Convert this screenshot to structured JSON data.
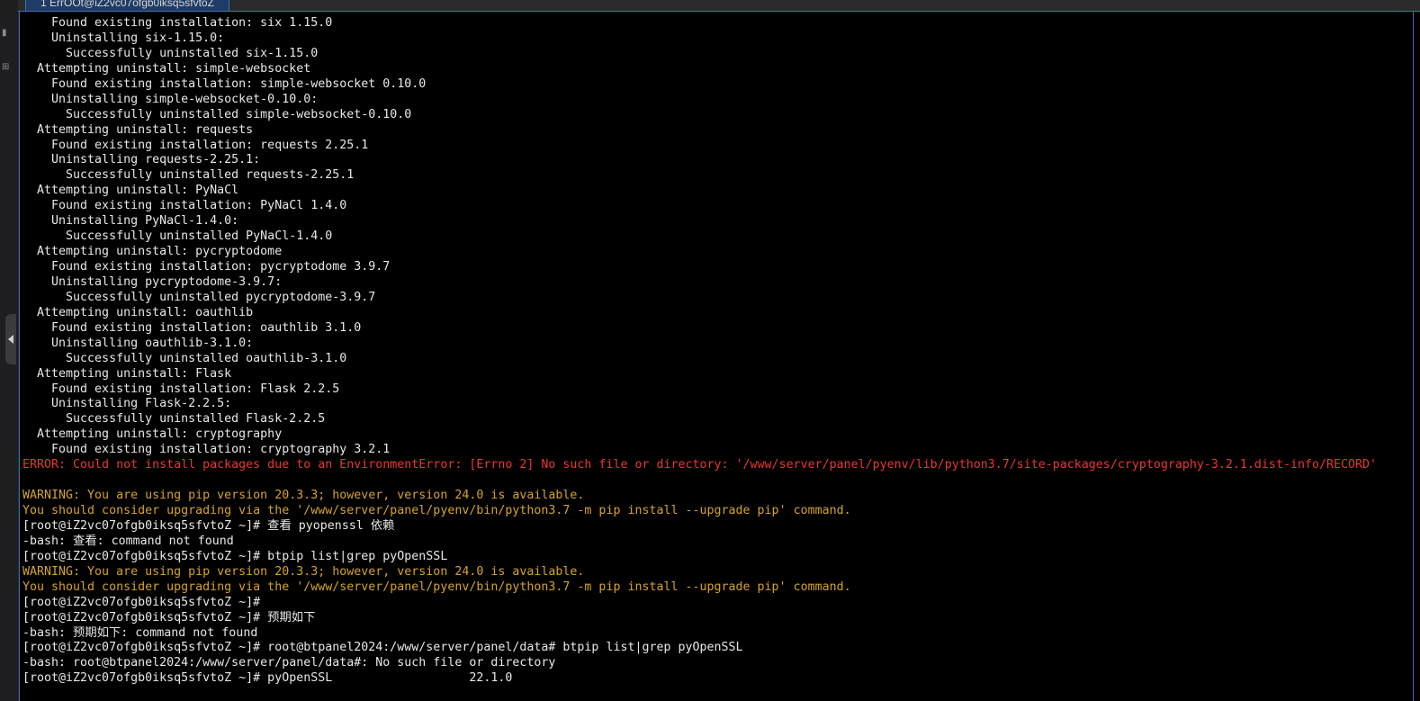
{
  "tab": {
    "title": "1 ErrOOt@iZ2vc07ofgb0iksq5sfvtoZ"
  },
  "sidebar": {
    "icons": [
      "square-icon",
      "grid-icon"
    ]
  },
  "terminal": {
    "lines": [
      {
        "text": "    Found existing installation: six 1.15.0",
        "kind": "normal"
      },
      {
        "text": "    Uninstalling six-1.15.0:",
        "kind": "normal"
      },
      {
        "text": "      Successfully uninstalled six-1.15.0",
        "kind": "normal"
      },
      {
        "text": "  Attempting uninstall: simple-websocket",
        "kind": "normal"
      },
      {
        "text": "    Found existing installation: simple-websocket 0.10.0",
        "kind": "normal"
      },
      {
        "text": "    Uninstalling simple-websocket-0.10.0:",
        "kind": "normal"
      },
      {
        "text": "      Successfully uninstalled simple-websocket-0.10.0",
        "kind": "normal"
      },
      {
        "text": "  Attempting uninstall: requests",
        "kind": "normal"
      },
      {
        "text": "    Found existing installation: requests 2.25.1",
        "kind": "normal"
      },
      {
        "text": "    Uninstalling requests-2.25.1:",
        "kind": "normal"
      },
      {
        "text": "      Successfully uninstalled requests-2.25.1",
        "kind": "normal"
      },
      {
        "text": "  Attempting uninstall: PyNaCl",
        "kind": "normal"
      },
      {
        "text": "    Found existing installation: PyNaCl 1.4.0",
        "kind": "normal"
      },
      {
        "text": "    Uninstalling PyNaCl-1.4.0:",
        "kind": "normal"
      },
      {
        "text": "      Successfully uninstalled PyNaCl-1.4.0",
        "kind": "normal"
      },
      {
        "text": "  Attempting uninstall: pycryptodome",
        "kind": "normal"
      },
      {
        "text": "    Found existing installation: pycryptodome 3.9.7",
        "kind": "normal"
      },
      {
        "text": "    Uninstalling pycryptodome-3.9.7:",
        "kind": "normal"
      },
      {
        "text": "      Successfully uninstalled pycryptodome-3.9.7",
        "kind": "normal"
      },
      {
        "text": "  Attempting uninstall: oauthlib",
        "kind": "normal"
      },
      {
        "text": "    Found existing installation: oauthlib 3.1.0",
        "kind": "normal"
      },
      {
        "text": "    Uninstalling oauthlib-3.1.0:",
        "kind": "normal"
      },
      {
        "text": "      Successfully uninstalled oauthlib-3.1.0",
        "kind": "normal"
      },
      {
        "text": "  Attempting uninstall: Flask",
        "kind": "normal"
      },
      {
        "text": "    Found existing installation: Flask 2.2.5",
        "kind": "normal"
      },
      {
        "text": "    Uninstalling Flask-2.2.5:",
        "kind": "normal"
      },
      {
        "text": "      Successfully uninstalled Flask-2.2.5",
        "kind": "normal"
      },
      {
        "text": "  Attempting uninstall: cryptography",
        "kind": "normal"
      },
      {
        "text": "    Found existing installation: cryptography 3.2.1",
        "kind": "normal"
      },
      {
        "text": "ERROR: Could not install packages due to an EnvironmentError: [Errno 2] No such file or directory: '/www/server/panel/pyenv/lib/python3.7/site-packages/cryptography-3.2.1.dist-info/RECORD'",
        "kind": "error"
      },
      {
        "text": "",
        "kind": "normal"
      },
      {
        "text": "WARNING: You are using pip version 20.3.3; however, version 24.0 is available.",
        "kind": "warn"
      },
      {
        "text": "You should consider upgrading via the '/www/server/panel/pyenv/bin/python3.7 -m pip install --upgrade pip' command.",
        "kind": "warn"
      },
      {
        "text": "[root@iZ2vc07ofgb0iksq5sfvtoZ ~]# 查看 pyopenssl 依赖",
        "kind": "normal"
      },
      {
        "text": "-bash: 查看: command not found",
        "kind": "normal"
      },
      {
        "text": "[root@iZ2vc07ofgb0iksq5sfvtoZ ~]# btpip list|grep pyOpenSSL",
        "kind": "normal"
      },
      {
        "text": "WARNING: You are using pip version 20.3.3; however, version 24.0 is available.",
        "kind": "warn"
      },
      {
        "text": "You should consider upgrading via the '/www/server/panel/pyenv/bin/python3.7 -m pip install --upgrade pip' command.",
        "kind": "warn"
      },
      {
        "text": "[root@iZ2vc07ofgb0iksq5sfvtoZ ~]#",
        "kind": "normal"
      },
      {
        "text": "[root@iZ2vc07ofgb0iksq5sfvtoZ ~]# 预期如下",
        "kind": "normal"
      },
      {
        "text": "-bash: 预期如下: command not found",
        "kind": "normal"
      },
      {
        "text": "[root@iZ2vc07ofgb0iksq5sfvtoZ ~]# root@btpanel2024:/www/server/panel/data# btpip list|grep pyOpenSSL",
        "kind": "normal"
      },
      {
        "text": "-bash: root@btpanel2024:/www/server/panel/data#: No such file or directory",
        "kind": "normal"
      },
      {
        "text": "[root@iZ2vc07ofgb0iksq5sfvtoZ ~]# pyOpenSSL                   22.1.0",
        "kind": "normal"
      }
    ]
  },
  "colors": {
    "background": "#000000",
    "text": "#e8e8e8",
    "error": "#e8382f",
    "warning": "#d4a32a",
    "accent": "#3c6fb5"
  }
}
